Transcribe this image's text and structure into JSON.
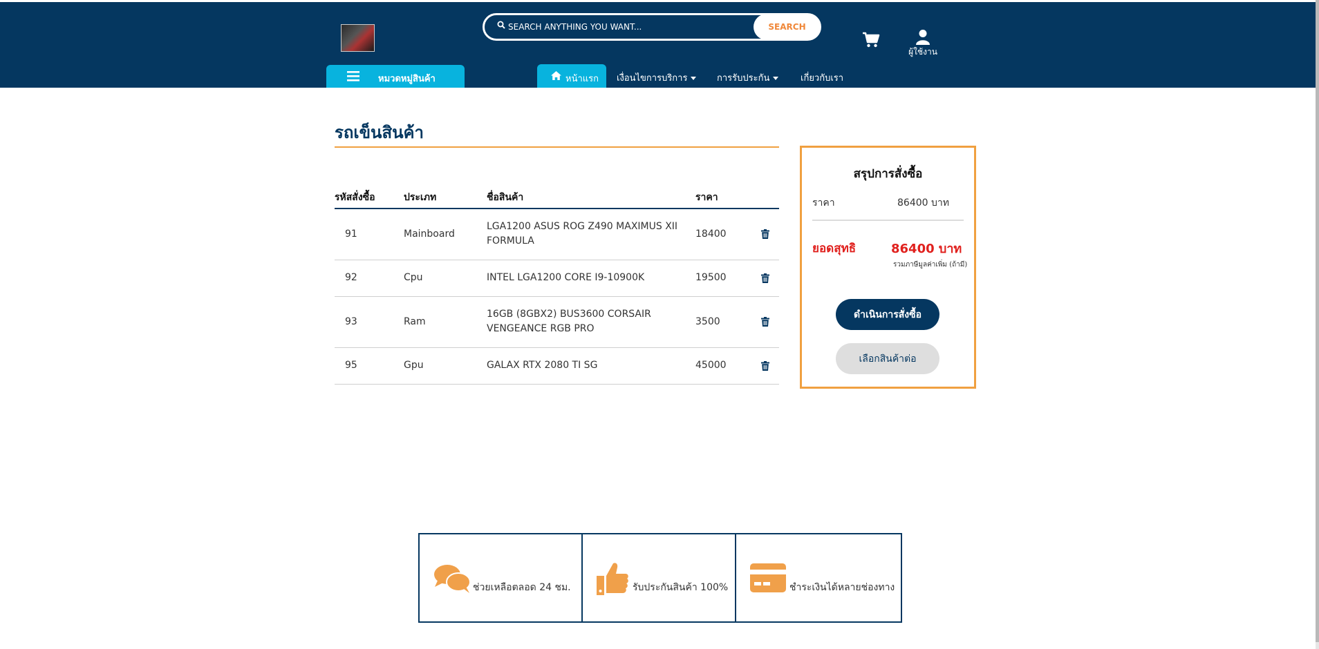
{
  "header": {
    "search_placeholder": "SEARCH ANYTHING YOU WANT...",
    "search_button": "SEARCH",
    "user_label": "ผู้ใช้งาน",
    "categories_label": "หมวดหมู่สินค้า",
    "nav": {
      "home": "หน้าแรก",
      "terms": "เงื่อนไขการบริการ",
      "warranty": "การรับประกัน",
      "about": "เกี่ยวกับเรา"
    }
  },
  "cart": {
    "title": "รถเข็นสินค้า",
    "columns": [
      "รหัสสั่งซื้อ",
      "ประเภท",
      "ชื่อสินค้า",
      "ราคา"
    ],
    "rows": [
      {
        "id": "91",
        "type": "Mainboard",
        "name": "LGA1200 ASUS ROG Z490 MAXIMUS XII FORMULA",
        "price": "18400"
      },
      {
        "id": "92",
        "type": "Cpu",
        "name": "INTEL LGA1200 CORE I9-10900K",
        "price": "19500"
      },
      {
        "id": "93",
        "type": "Ram",
        "name": "16GB (8GBX2) BUS3600 CORSAIR VENGEANCE RGB PRO",
        "price": "3500"
      },
      {
        "id": "95",
        "type": "Gpu",
        "name": "GALAX RTX 2080 TI SG",
        "price": "45000"
      }
    ]
  },
  "summary": {
    "title": "สรุปการสั่งซื้อ",
    "price_label": "ราคา",
    "price_value": "86400 บาท",
    "net_label": "ยอดสุทธิ",
    "net_value": "86400 บาท",
    "vat_note": "รวมภาษีมูลค่าเพิ่ม (ถ้ามี)",
    "checkout_button": "ดำเนินการสั่งซื้อ",
    "continue_button": "เลือกสินค้าต่อ"
  },
  "features": [
    {
      "icon": "chat-bubbles-icon",
      "text": "ช่วยเหลือตลอด 24 ชม."
    },
    {
      "icon": "thumbs-up-icon",
      "text": "รับประกันสินค้า 100%"
    },
    {
      "icon": "credit-card-icon",
      "text": "ชำระเงินได้หลายช่องทาง"
    }
  ],
  "colors": {
    "header_bg": "#053760",
    "accent_blue": "#08b3de",
    "accent_orange": "#f0a040",
    "net_red": "#e0201d"
  }
}
